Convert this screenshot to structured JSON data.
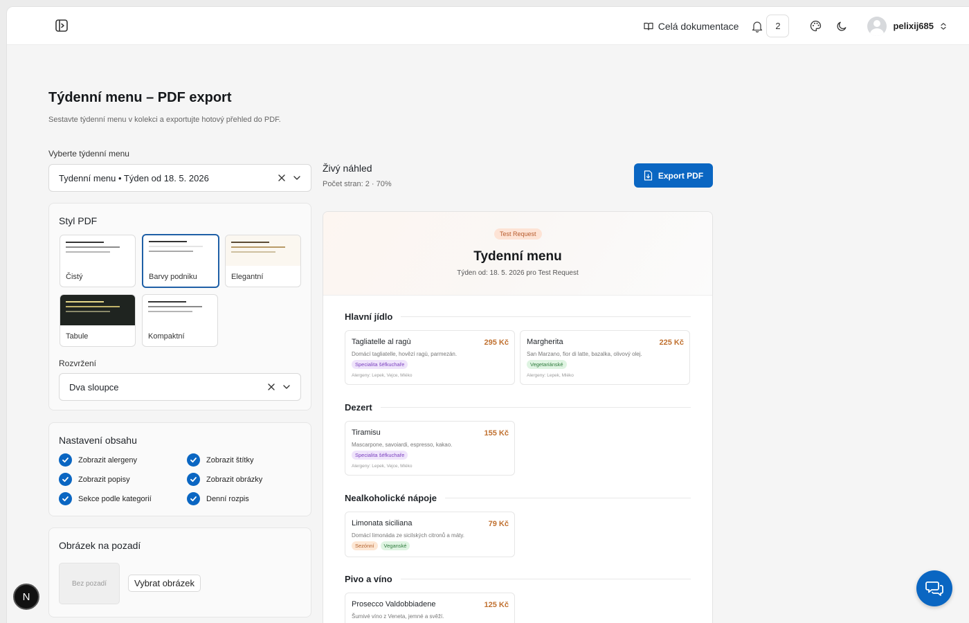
{
  "header": {
    "docs_label": "Celá dokumentace",
    "notifications_count": "2",
    "username": "pelixij685"
  },
  "page": {
    "title": "Týdenní menu – PDF export",
    "subtitle": "Sestavte týdenní menu v kolekci a exportujte hotový přehled do PDF."
  },
  "menu_select": {
    "label": "Vyberte týdenní menu",
    "value": "Tydenní menu • Týden od 18. 5. 2026"
  },
  "pdf_style": {
    "title": "Styl PDF",
    "options": [
      "Čistý",
      "Barvy podniku",
      "Elegantní",
      "Tabule",
      "Kompaktní"
    ],
    "selected": "Barvy podniku",
    "layout_label": "Rozvržení",
    "layout_value": "Dva sloupce"
  },
  "content_settings": {
    "title": "Nastavení obsahu",
    "options": [
      {
        "label": "Zobrazit alergeny",
        "checked": true
      },
      {
        "label": "Zobrazit štítky",
        "checked": true
      },
      {
        "label": "Zobrazit popisy",
        "checked": true
      },
      {
        "label": "Zobrazit obrázky",
        "checked": true
      },
      {
        "label": "Sekce podle kategorií",
        "checked": true
      },
      {
        "label": "Denní rozpis",
        "checked": true
      }
    ]
  },
  "background": {
    "title": "Obrázek na pozadí",
    "placeholder": "Bez pozadí",
    "button": "Vybrat obrázek"
  },
  "live_preview": {
    "title": "Živý náhled",
    "info": "Počet stran: 2 · 70%",
    "export_label": "Export PDF"
  },
  "preview": {
    "tag": "Test Request",
    "title": "Tydenní menu",
    "subtitle": "Týden od: 18. 5. 2026 pro Test Request",
    "sections": [
      {
        "name": "Hlavní jídlo",
        "items": [
          {
            "name": "Tagliatelle al ragù",
            "price": "295 Kč",
            "desc": "Domácí tagliatelle, hovězí ragù, parmezán.",
            "tags": [
              {
                "text": "Specialita šéfkuchaře",
                "color": "purple"
              }
            ],
            "allergens": "Alergeny: Lepek, Vejce, Mléko"
          },
          {
            "name": "Margherita",
            "price": "225 Kč",
            "desc": "San Marzano, fior di latte, bazalka, olivový olej.",
            "tags": [
              {
                "text": "Vegetariánské",
                "color": "green"
              }
            ],
            "allergens": "Alergeny: Lepek, Mléko"
          }
        ]
      },
      {
        "name": "Dezert",
        "items": [
          {
            "name": "Tiramisu",
            "price": "155 Kč",
            "desc": "Mascarpone, savoiardi, espresso, kakao.",
            "tags": [
              {
                "text": "Specialita šéfkuchaře",
                "color": "purple"
              }
            ],
            "allergens": "Alergeny: Lepek, Vejce, Mléko"
          }
        ]
      },
      {
        "name": "Nealkoholické nápoje",
        "items": [
          {
            "name": "Limonata siciliana",
            "price": "79 Kč",
            "desc": "Domácí limonáda ze sicilských citronů a máty.",
            "tags": [
              {
                "text": "Sezónní",
                "color": "orange"
              },
              {
                "text": "Veganské",
                "color": "green"
              }
            ],
            "allergens": ""
          }
        ]
      },
      {
        "name": "Pivo a víno",
        "items": [
          {
            "name": "Prosecco Valdobbiadene",
            "price": "125 Kč",
            "desc": "Šumivé víno z Veneta, jemné a svěží.",
            "tags": [],
            "allergens": ""
          }
        ]
      }
    ]
  },
  "floating": {
    "dev_badge": "N"
  }
}
